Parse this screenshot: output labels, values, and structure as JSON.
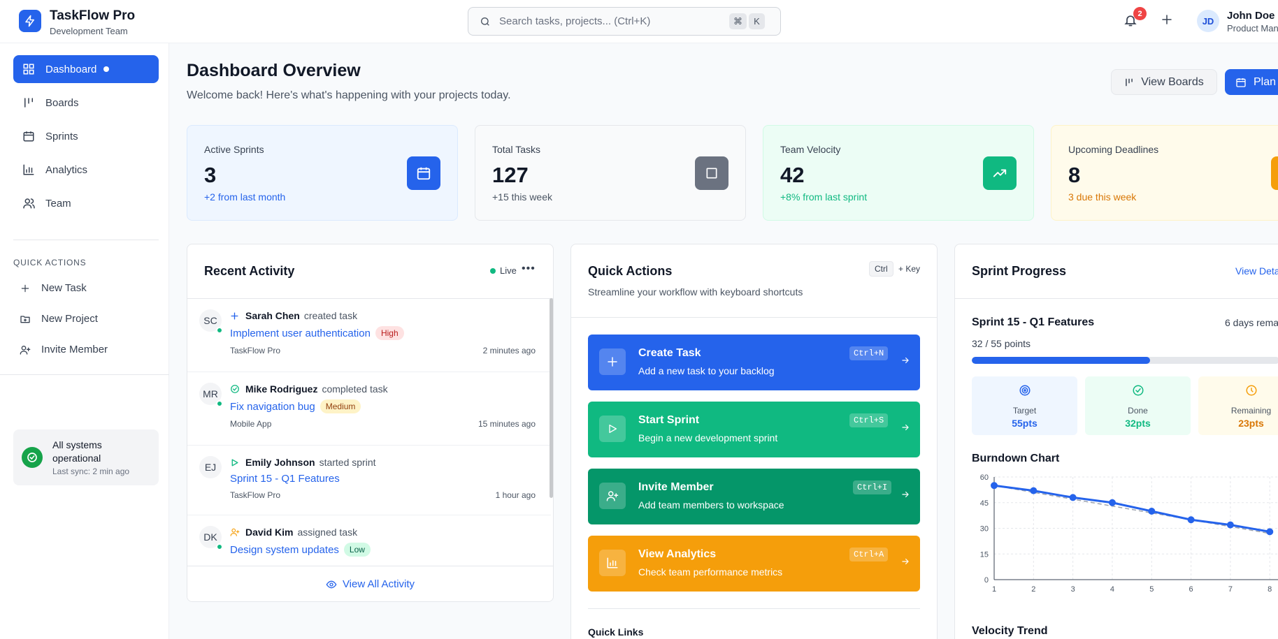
{
  "header": {
    "app_name": "TaskFlow Pro",
    "team": "Development Team",
    "search_placeholder": "Search tasks, projects... (Ctrl+K)",
    "search_keys": [
      "⌘",
      "K"
    ],
    "notifications_count": "2",
    "user_initials": "JD",
    "user_name": "John Doe",
    "user_role": "Product Man"
  },
  "sidebar": {
    "nav": [
      {
        "label": "Dashboard",
        "icon": "grid-icon",
        "active": true
      },
      {
        "label": "Boards",
        "icon": "columns-icon"
      },
      {
        "label": "Sprints",
        "icon": "calendar-icon"
      },
      {
        "label": "Analytics",
        "icon": "bar-chart-icon"
      },
      {
        "label": "Team",
        "icon": "users-icon"
      }
    ],
    "quick_actions_title": "QUICK ACTIONS",
    "quick_actions": [
      {
        "label": "New Task",
        "icon": "plus-icon"
      },
      {
        "label": "New Project",
        "icon": "folder-plus-icon"
      },
      {
        "label": "Invite Member",
        "icon": "user-plus-icon"
      }
    ],
    "system_status": {
      "title": "All systems operational",
      "sync": "Last sync: 2 min ago"
    }
  },
  "page": {
    "title": "Dashboard Overview",
    "subtitle": "Welcome back! Here's what's happening with your projects today.",
    "view_boards_label": "View Boards",
    "plan_label": "Plan"
  },
  "stats": [
    {
      "label": "Active Sprints",
      "value": "3",
      "sub": "+2 from last month",
      "icon": "calendar-icon",
      "color": "#2563eb"
    },
    {
      "label": "Total Tasks",
      "value": "127",
      "sub": "+15 this week",
      "icon": "square-icon",
      "color": "#6b7280"
    },
    {
      "label": "Team Velocity",
      "value": "42",
      "sub": "+8% from last sprint",
      "icon": "trending-up-icon",
      "color": "#10b981"
    },
    {
      "label": "Upcoming Deadlines",
      "value": "8",
      "sub": "3 due this week",
      "icon": "clock-icon",
      "color": "#f59e0b"
    }
  ],
  "activity": {
    "title": "Recent Activity",
    "live_label": "Live",
    "items": [
      {
        "initials": "SC",
        "name": "Sarah Chen",
        "action": "created task",
        "task": "Implement user authentication",
        "priority": "High",
        "project": "TaskFlow Pro",
        "time": "2 minutes ago",
        "icon": "plus-icon"
      },
      {
        "initials": "MR",
        "name": "Mike Rodriguez",
        "action": "completed task",
        "task": "Fix navigation bug",
        "priority": "Medium",
        "project": "Mobile App",
        "time": "15 minutes ago",
        "icon": "check-circle-icon"
      },
      {
        "initials": "EJ",
        "name": "Emily Johnson",
        "action": "started sprint",
        "task": "Sprint 15 - Q1 Features",
        "priority": "",
        "project": "TaskFlow Pro",
        "time": "1 hour ago",
        "icon": "play-icon"
      },
      {
        "initials": "DK",
        "name": "David Kim",
        "action": "assigned task",
        "task": "Design system updates",
        "priority": "Low",
        "project": "",
        "time": "",
        "icon": "user-plus-icon"
      }
    ],
    "view_all_label": "View All Activity"
  },
  "quick_actions": {
    "title": "Quick Actions",
    "subtitle": "Streamline your workflow with keyboard shortcuts",
    "kbd_label": "Ctrl",
    "key_label": "+ Key",
    "cards": [
      {
        "title": "Create Task",
        "sub": "Add a new task to your backlog",
        "shortcut": "Ctrl+N",
        "color": "#2563eb",
        "icon": "plus-icon"
      },
      {
        "title": "Start Sprint",
        "sub": "Begin a new development sprint",
        "shortcut": "Ctrl+S",
        "color": "#10b981",
        "icon": "play-icon"
      },
      {
        "title": "Invite Member",
        "sub": "Add team members to workspace",
        "shortcut": "Ctrl+I",
        "color": "#059669",
        "icon": "user-plus-icon"
      },
      {
        "title": "View Analytics",
        "sub": "Check team performance metrics",
        "shortcut": "Ctrl+A",
        "color": "#f59e0b",
        "icon": "bar-chart-icon"
      }
    ],
    "links_title": "Quick Links"
  },
  "sprint": {
    "title": "Sprint Progress",
    "details_link": "View Deta",
    "name": "Sprint 15 - Q1 Features",
    "days_remaining": "6 days rema",
    "points": "32 / 55 points",
    "progress": 0.58,
    "target_label": "Target",
    "target_value": "55pts",
    "done_label": "Done",
    "done_value": "32pts",
    "remaining_label": "Remaining",
    "remaining_value": "23pts",
    "burndown_title": "Burndown Chart",
    "velocity_title": "Velocity Trend"
  },
  "chart_data": {
    "type": "line",
    "title": "Burndown Chart",
    "x": [
      1,
      2,
      3,
      4,
      5,
      6,
      7,
      8
    ],
    "series": [
      {
        "values": [
          55,
          52,
          48,
          45,
          40,
          35,
          32,
          28
        ],
        "color": "#2563eb"
      },
      {
        "values": [
          55,
          51,
          47,
          43,
          39,
          35,
          31,
          27
        ],
        "color": "#9ca3af",
        "style": "dashed"
      }
    ],
    "yticks": [
      0,
      15,
      30,
      45,
      60
    ],
    "ylim": [
      0,
      60
    ],
    "xlim": [
      1,
      8
    ],
    "grid": true
  }
}
